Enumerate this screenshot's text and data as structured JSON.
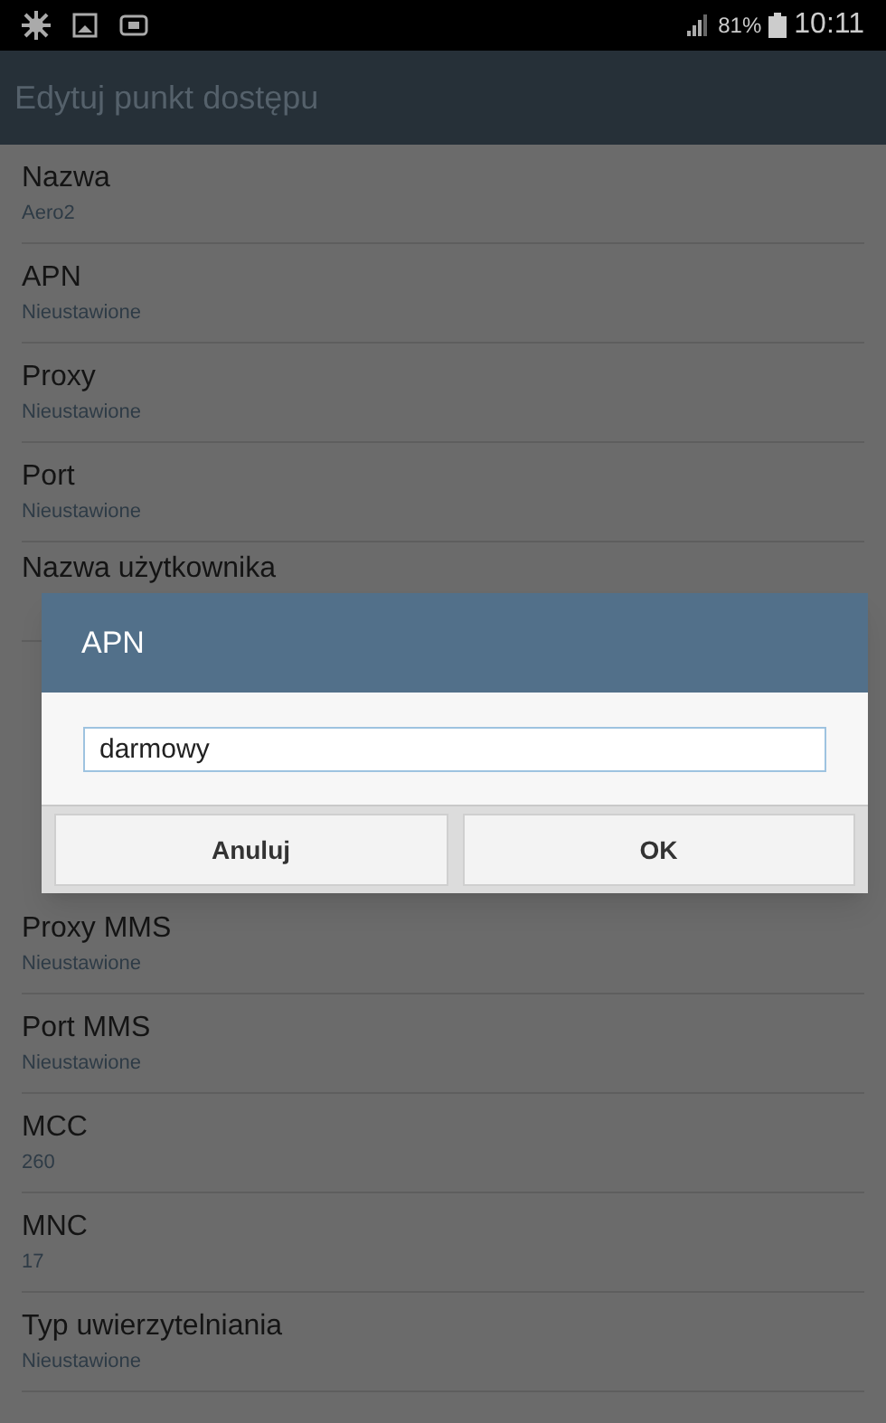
{
  "status_bar": {
    "battery": "81%",
    "time": "10:11"
  },
  "title_bar": {
    "title": "Edytuj punkt dostępu"
  },
  "settings": [
    {
      "title": "Nazwa",
      "summary": "Aero2"
    },
    {
      "title": "APN",
      "summary": "Nieustawione"
    },
    {
      "title": "Proxy",
      "summary": "Nieustawione"
    },
    {
      "title": "Port",
      "summary": "Nieustawione"
    },
    {
      "title": "Nazwa użytkownika"
    },
    {
      "title": "Proxy MMS",
      "summary": "Nieustawione"
    },
    {
      "title": "Port MMS",
      "summary": "Nieustawione"
    },
    {
      "title": "MCC",
      "summary": "260"
    },
    {
      "title": "MNC",
      "summary": "17"
    },
    {
      "title": "Typ uwierzytelniania",
      "summary": "Nieustawione"
    }
  ],
  "dialog": {
    "title": "APN",
    "value": "darmowy",
    "buttons": [
      "Anuluj",
      "OK"
    ]
  }
}
